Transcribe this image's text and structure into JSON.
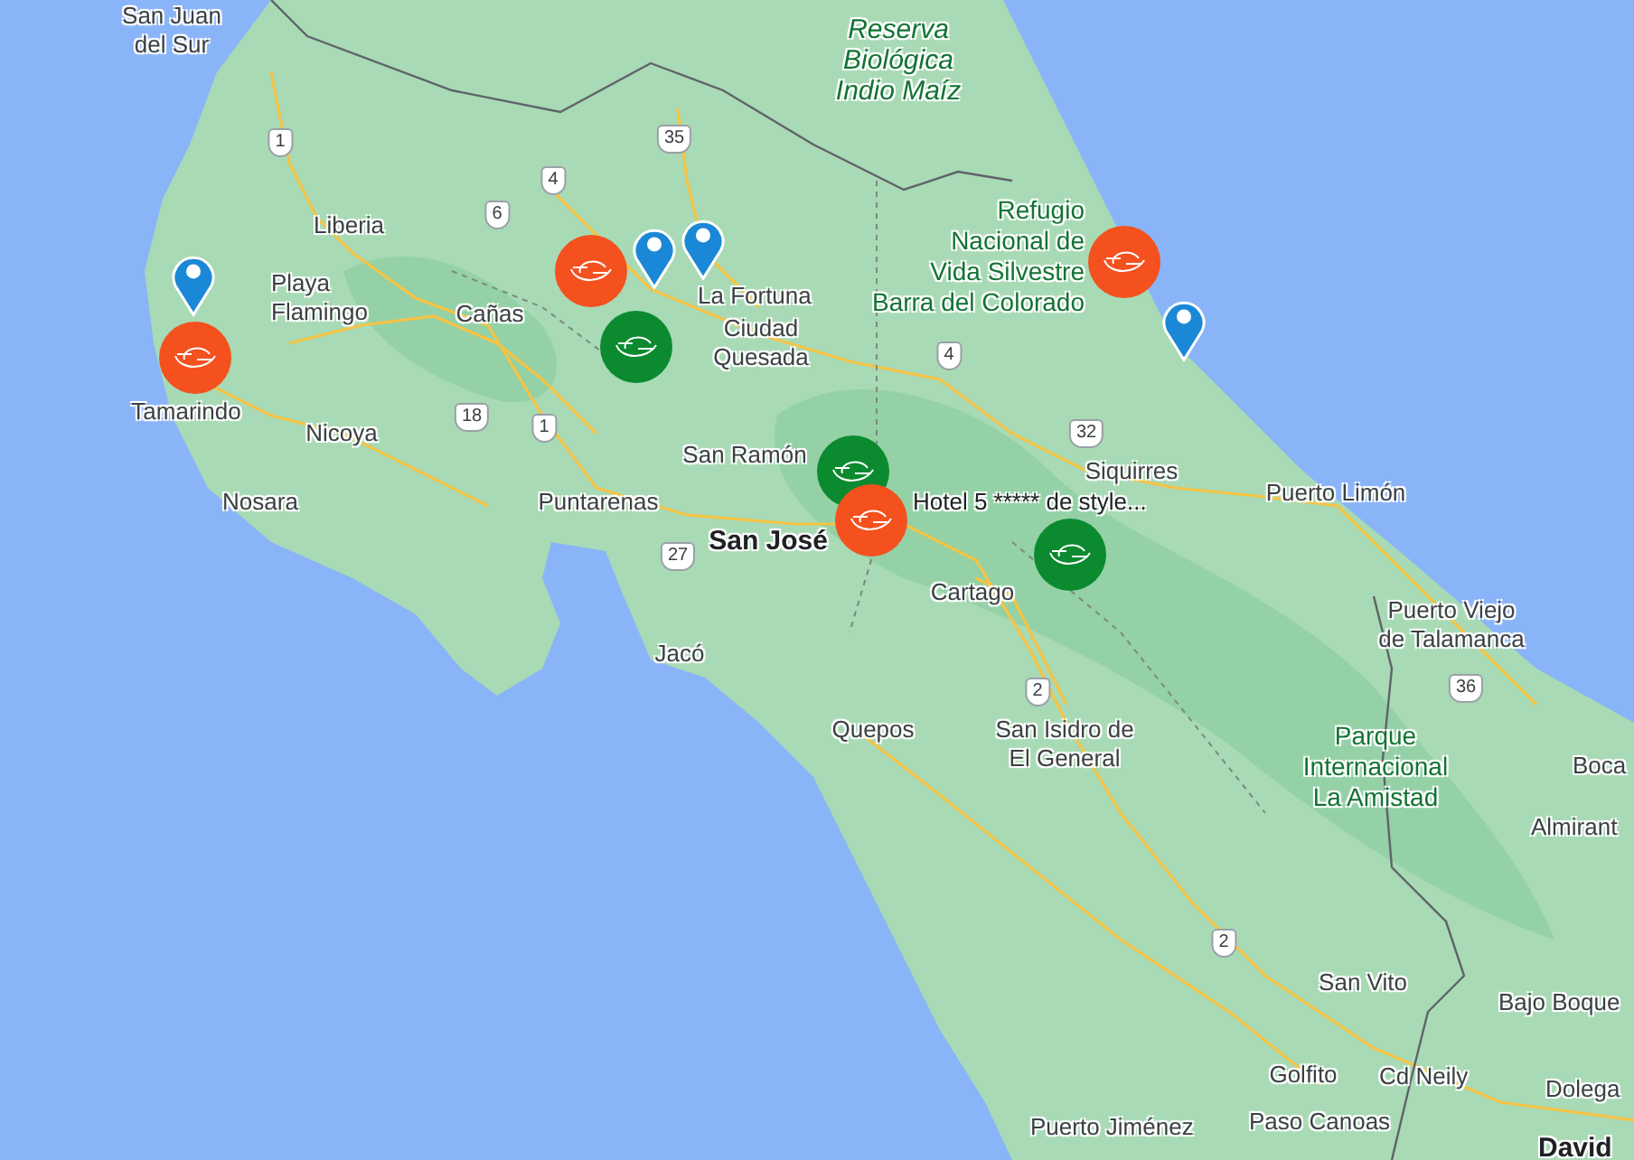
{
  "map": {
    "place_labels": [
      {
        "kind": "city",
        "lines": [
          "San Juan",
          "del Sur"
        ]
      },
      {
        "kind": "city",
        "lines": [
          "Liberia"
        ]
      },
      {
        "kind": "city",
        "lines": [
          "Playa",
          "Flamingo"
        ]
      },
      {
        "kind": "city",
        "lines": [
          "Tamarindo"
        ]
      },
      {
        "kind": "city",
        "lines": [
          "Cañas"
        ]
      },
      {
        "kind": "city",
        "lines": [
          "Nicoya"
        ]
      },
      {
        "kind": "city",
        "lines": [
          "Nosara"
        ]
      },
      {
        "kind": "city",
        "lines": [
          "Puntarenas"
        ]
      },
      {
        "kind": "city",
        "lines": [
          "La Fortuna"
        ]
      },
      {
        "kind": "city",
        "lines": [
          "Ciudad",
          "Quesada"
        ]
      },
      {
        "kind": "city",
        "lines": [
          "San Ramón"
        ]
      },
      {
        "kind": "capital",
        "lines": [
          "San José"
        ]
      },
      {
        "kind": "marker_label",
        "lines": [
          "Hotel 5 ***** de style..."
        ]
      },
      {
        "kind": "city",
        "lines": [
          "Cartago"
        ]
      },
      {
        "kind": "city",
        "lines": [
          "Siquirres"
        ]
      },
      {
        "kind": "city",
        "lines": [
          "Puerto Limón"
        ]
      },
      {
        "kind": "city",
        "lines": [
          "Jacó"
        ]
      },
      {
        "kind": "city",
        "lines": [
          "Quepos"
        ]
      },
      {
        "kind": "city",
        "lines": [
          "San Isidro de",
          "El General"
        ]
      },
      {
        "kind": "city",
        "lines": [
          "Puerto Viejo",
          "de Talamanca"
        ]
      },
      {
        "kind": "city",
        "lines": [
          "Boca"
        ]
      },
      {
        "kind": "city",
        "lines": [
          "Almirant"
        ]
      },
      {
        "kind": "city",
        "lines": [
          "San Vito"
        ]
      },
      {
        "kind": "city",
        "lines": [
          "Bajo Boque"
        ]
      },
      {
        "kind": "city",
        "lines": [
          "Golfito"
        ]
      },
      {
        "kind": "city",
        "lines": [
          "Cd Neily"
        ]
      },
      {
        "kind": "city",
        "lines": [
          "Dolega"
        ]
      },
      {
        "kind": "city",
        "lines": [
          "Puerto Jiménez"
        ]
      },
      {
        "kind": "city",
        "lines": [
          "Paso Canoas"
        ]
      },
      {
        "kind": "capital",
        "lines": [
          "David"
        ]
      },
      {
        "kind": "reserve",
        "lines": [
          "Reserva",
          "Biológica",
          "Indio Maíz"
        ]
      },
      {
        "kind": "park",
        "lines": [
          "Refugio",
          "Nacional de",
          "Vida Silvestre",
          "Barra del Colorado"
        ]
      },
      {
        "kind": "park",
        "lines": [
          "Parque",
          "Internacional",
          "La Amistad"
        ]
      }
    ],
    "route_shields": [
      {
        "number": "1"
      },
      {
        "number": "35"
      },
      {
        "number": "4"
      },
      {
        "number": "6"
      },
      {
        "number": "18"
      },
      {
        "number": "1"
      },
      {
        "number": "27"
      },
      {
        "number": "4"
      },
      {
        "number": "32"
      },
      {
        "number": "2"
      },
      {
        "number": "2"
      },
      {
        "number": "36"
      }
    ],
    "markers": [
      {
        "kind": "cluster",
        "color": "#f4511e"
      },
      {
        "kind": "pin"
      },
      {
        "kind": "cluster",
        "color": "#f4511e"
      },
      {
        "kind": "pin"
      },
      {
        "kind": "pin"
      },
      {
        "kind": "cluster",
        "color": "#0b8a2f"
      },
      {
        "kind": "cluster",
        "color": "#f4511e"
      },
      {
        "kind": "pin"
      },
      {
        "kind": "cluster",
        "color": "#0b8a2f"
      },
      {
        "kind": "cluster",
        "color": "#f4511e"
      },
      {
        "kind": "cluster",
        "color": "#0b8a2f"
      }
    ]
  }
}
